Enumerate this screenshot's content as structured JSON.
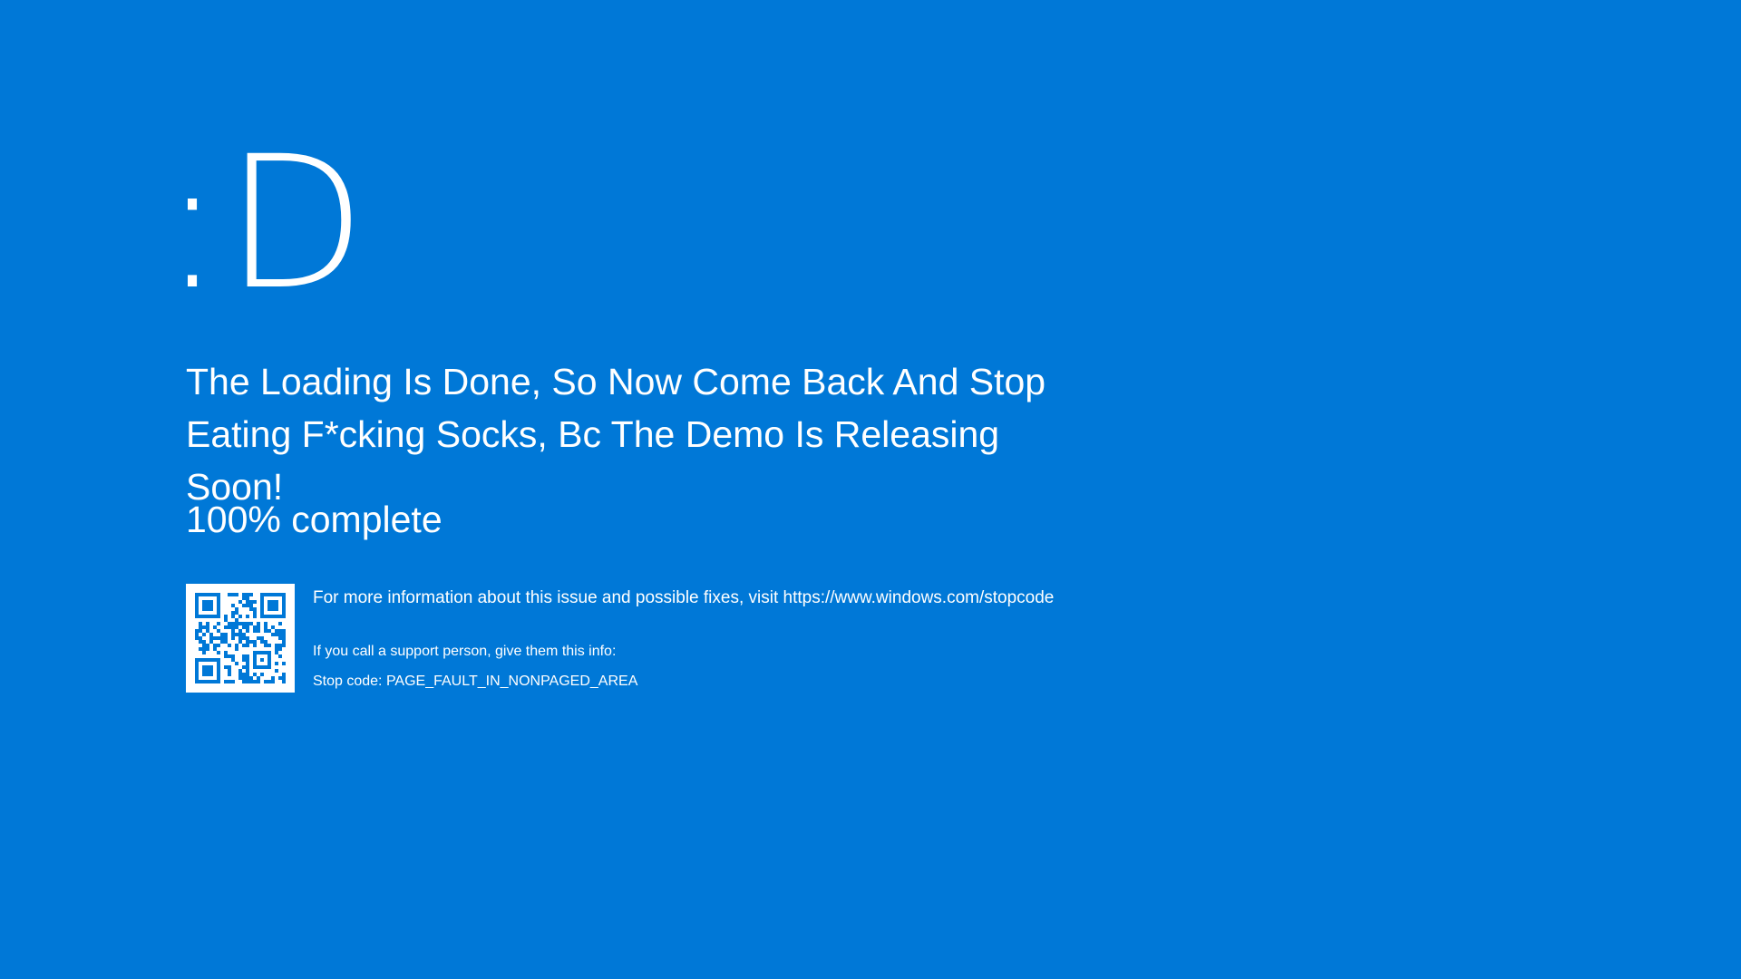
{
  "screen": {
    "background_color": "#0078d7",
    "text_color": "#ffffff",
    "face": ":D",
    "message_line1": "The Loading Is Done, So Now Come Back And Stop",
    "message_line2": "Eating F*cking Socks, Bc The Demo Is Releasing Soon!",
    "progress": {
      "text": "100% complete",
      "percent": 100
    },
    "qr_code": {
      "icon": "qr-code-icon"
    },
    "info": "For more information about this issue and possible fixes, visit https://www.windows.com/stopcode",
    "support": "If you call a support person, give them this info:",
    "stop_code": "Stop code: PAGE_FAULT_IN_NONPAGED_AREA"
  }
}
